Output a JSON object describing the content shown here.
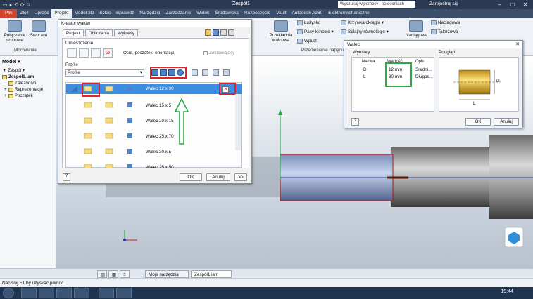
{
  "app": {
    "title": "Zespół1",
    "help_placeholder": "Wyszukaj w pomocy i poleceniach",
    "signin": "Zarejestruj się",
    "quick_access": [
      "▭",
      "▸",
      "⟲",
      "⟳",
      "⌂"
    ]
  },
  "tabs": [
    "Plik",
    "Złóż",
    "Uprość",
    "Projekt",
    "Model 3D",
    "Szkic",
    "Sprawdź",
    "Narzędzia",
    "Zarządzanie",
    "Widok",
    "Środowiska",
    "Rozpoczęcie",
    "Vault",
    "Autodesk A360",
    "Elektromechaniczne"
  ],
  "ribbon": {
    "btn_bolted": "Połączenie śrubowe",
    "btn_fasten": "Sworzeń",
    "group_mount": "Mocowanie",
    "btn_gear": "Przekładnia walcowa",
    "items_col1": [
      "Łożysko",
      "Pasy klinowe ▾",
      "Wpust"
    ],
    "items_col2": [
      "Krzywka okrągła ▾",
      "Splajny równoległe ▾"
    ],
    "group_power": "Przeniesienie napędu",
    "items_col3": [
      "Naciągowa",
      "Talerzowa"
    ],
    "btn_spring": "Naciągowa"
  },
  "browser": {
    "title": "Model ▾",
    "filter": "Zespół ▾",
    "items": [
      "Zespół1.iam",
      "Zależności",
      "Reprezentacje",
      "Początek"
    ]
  },
  "shaft_dialog": {
    "title": "Kreator wałów",
    "tabs": [
      "Projekt",
      "Obliczenia",
      "Wykresy"
    ],
    "placement_label": "Umieszczenie",
    "axes_label": "Osie, początek, orientacja",
    "checkbox_label": "Zestawiający",
    "profile_label": "Profile",
    "profile_dropdown": "Profile",
    "sections": [
      "Walec 12 x 30",
      "Walec 15 x 5",
      "Walec 20 x 15",
      "Walec 25 x 70",
      "Walec 30 x 5",
      "Walec 25 x 50"
    ],
    "ok": "OK",
    "cancel": "Anuluj",
    "more": ">>"
  },
  "cyl_dialog": {
    "title": "Walec",
    "dims_label": "Wymiary",
    "preview_label": "Podgląd",
    "headers": [
      "Nazwa",
      "Wartość",
      "Opis"
    ],
    "rows": [
      {
        "name": "D",
        "value": "12 mm",
        "desc": "Średni..."
      },
      {
        "name": "L",
        "value": "30 mm",
        "desc": "Długos..."
      }
    ],
    "preview_d": "D",
    "preview_l": "L",
    "ok": "OK",
    "cancel": "Anuluj"
  },
  "doc_tabs": [
    "Moje narzędzia g...",
    "Zespół1.iam"
  ],
  "status": "Naciśnij F1 by uzyskać pomoc",
  "clock": "19:44",
  "colors": {
    "accent": "#d3452b",
    "highlight_red": "#e0232a",
    "highlight_green": "#2fa848",
    "selection": "#3d8ee0"
  }
}
